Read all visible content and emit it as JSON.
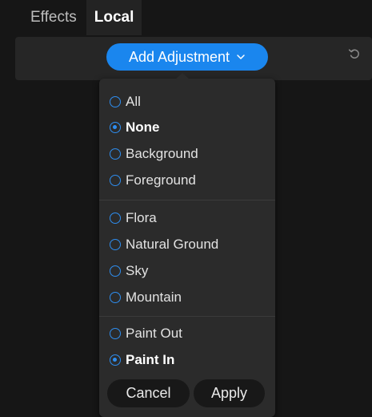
{
  "tabs": [
    {
      "label": "Effects",
      "active": false
    },
    {
      "label": "Local",
      "active": true
    }
  ],
  "toolbar": {
    "add_adjustment_label": "Add Adjustment",
    "accent_color": "#1a86ee"
  },
  "icons": {
    "dropdown": "chevron-down-icon",
    "reset": "undo-icon"
  },
  "menu": {
    "groups": [
      [
        {
          "label": "All",
          "selected": false
        },
        {
          "label": "None",
          "selected": true
        },
        {
          "label": "Background",
          "selected": false
        },
        {
          "label": "Foreground",
          "selected": false
        }
      ],
      [
        {
          "label": "Flora",
          "selected": false
        },
        {
          "label": "Natural Ground",
          "selected": false
        },
        {
          "label": "Sky",
          "selected": false
        },
        {
          "label": "Mountain",
          "selected": false
        }
      ],
      [
        {
          "label": "Paint Out",
          "selected": false
        },
        {
          "label": "Paint In",
          "selected": true
        }
      ]
    ],
    "cancel_label": "Cancel",
    "apply_label": "Apply"
  }
}
